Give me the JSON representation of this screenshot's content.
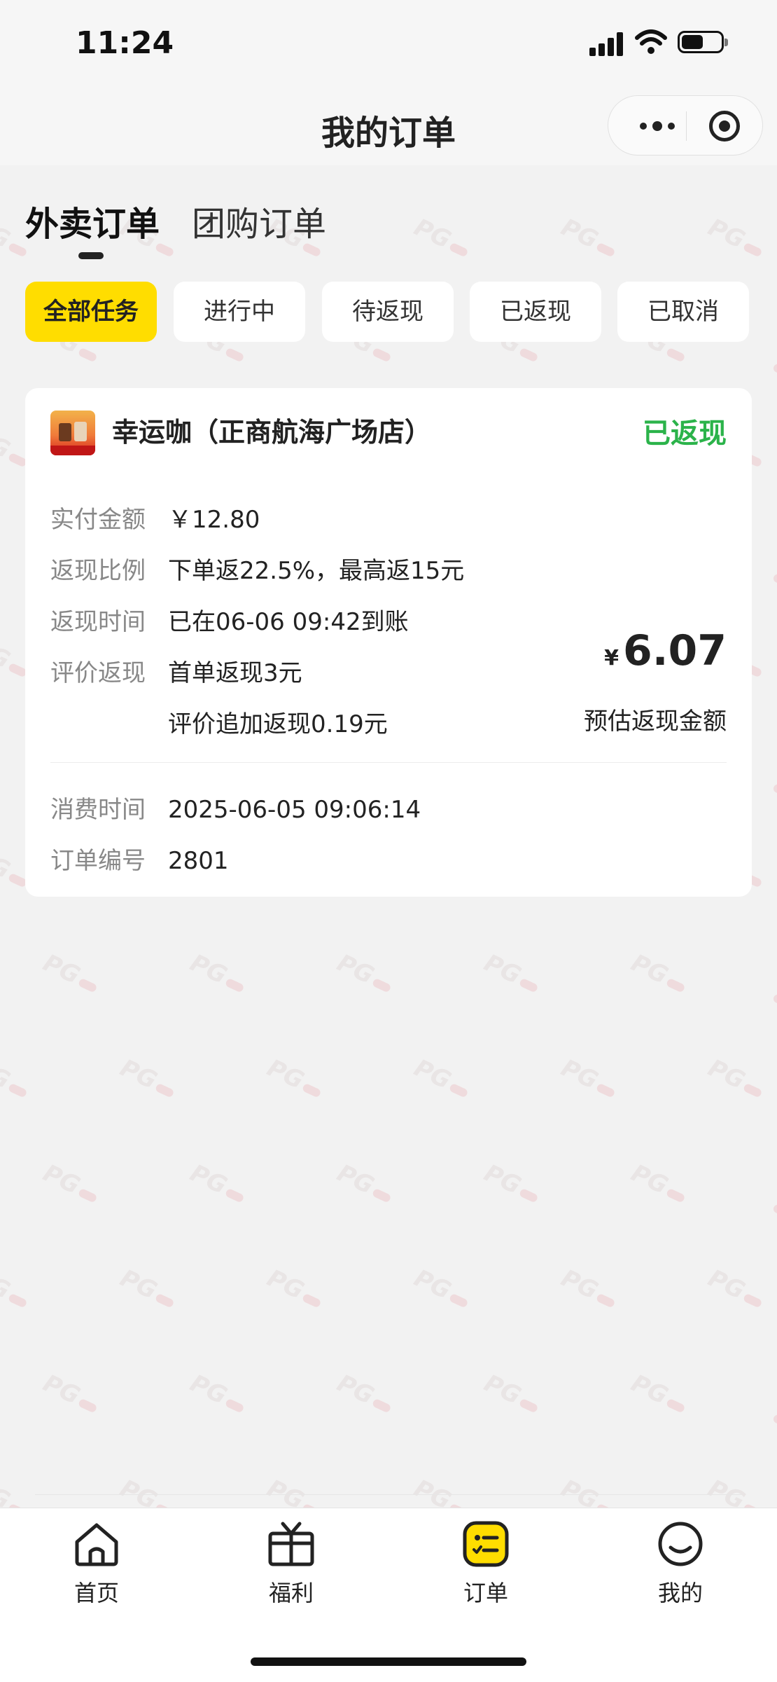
{
  "status_bar": {
    "time": "11:24"
  },
  "header": {
    "title": "我的订单"
  },
  "top_tabs": [
    {
      "label": "外卖订单",
      "active": true
    },
    {
      "label": "团购订单",
      "active": false
    }
  ],
  "filters": [
    {
      "label": "全部任务",
      "active": true
    },
    {
      "label": "进行中",
      "active": false
    },
    {
      "label": "待返现",
      "active": false
    },
    {
      "label": "已返现",
      "active": false
    },
    {
      "label": "已取消",
      "active": false
    }
  ],
  "order": {
    "shop_name": "幸运咖（正商航海广场店）",
    "status": "已返现",
    "status_color": "#2bb34a",
    "fields": [
      {
        "key": "实付金额",
        "value": "￥12.80"
      },
      {
        "key": "返现比例",
        "value": "下单返22.5%，最高返15元"
      },
      {
        "key": "返现时间",
        "value": "已在06-06 09:42到账"
      },
      {
        "key": "评价返现",
        "value": "首单返现3元"
      }
    ],
    "extra_line": "评价追加返现0.19元",
    "cashback_symbol": "¥",
    "cashback_amount": "6.07",
    "cashback_label": "预估返现金额",
    "consume_time_key": "消费时间",
    "consume_time": "2025-06-05 09:06:14",
    "order_no_key": "订单编号",
    "order_no": "2801"
  },
  "tabbar": [
    {
      "label": "首页",
      "icon": "home-icon",
      "active": false
    },
    {
      "label": "福利",
      "icon": "gift-icon",
      "active": false
    },
    {
      "label": "订单",
      "icon": "order-list-icon",
      "active": true
    },
    {
      "label": "我的",
      "icon": "profile-smile-icon",
      "active": false
    }
  ],
  "colors": {
    "accent": "#ffdd00",
    "success": "#2bb34a",
    "background": "#f2f2f2"
  }
}
